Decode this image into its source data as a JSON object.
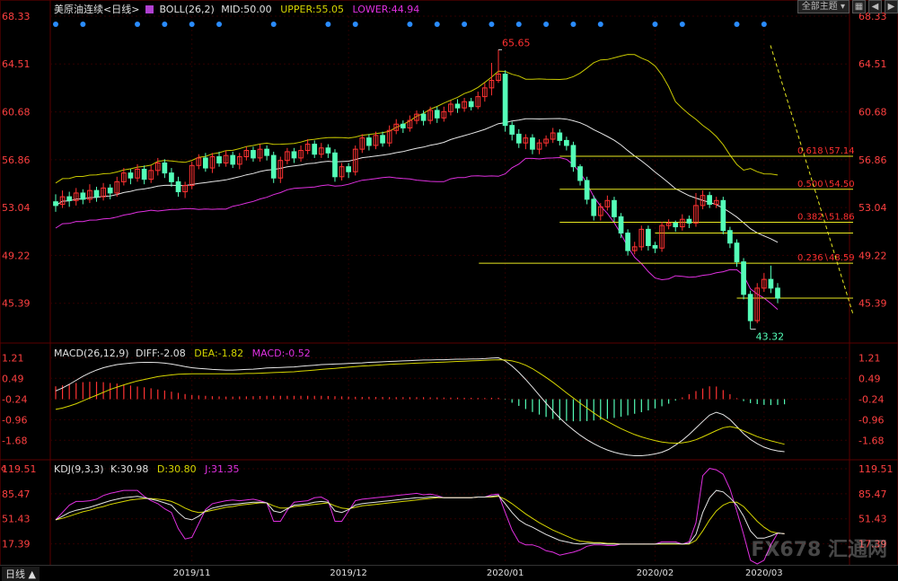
{
  "header": {
    "main": {
      "title": "美原油连续<日线>",
      "boll": "BOLL(26,2)",
      "mid": "MID:50.00",
      "upper": "UPPER:55.05",
      "lower": "LOWER:44.94"
    },
    "macd": {
      "title": "MACD(26,12,9)",
      "diff": "DIFF:-2.08",
      "dea": "DEA:-1.82",
      "macd": "MACD:-0.52"
    },
    "kdj": {
      "title": "KDJ(9,3,3)",
      "k": "K:30.98",
      "d": "D:30.80",
      "j": "J:31.35"
    }
  },
  "toolbar": {
    "theme_label": "全部主题",
    "icon1": "grid-icon",
    "icon2": "back-icon",
    "icon3": "forward-icon"
  },
  "bottom": {
    "tab_label": "日线 ▲"
  },
  "watermark": "FX678 汇通网",
  "colors": {
    "up": "#ff3232",
    "down": "#54ffb8",
    "upper": "#c8c800",
    "mid": "#e6e6e6",
    "lower": "#e030e0",
    "fib": "#e8e820",
    "axis": "#ff4040",
    "diff": "#e6e6e6",
    "dea": "#d6d600",
    "k": "#e6e6e6",
    "d": "#d6d600",
    "j": "#e030e0",
    "dot": "#2a8cff"
  },
  "chart_data": [
    {
      "type": "candlestick",
      "title": "美原油连续<日线>",
      "y_ticks": [
        "68.33",
        "64.51",
        "60.68",
        "56.86",
        "53.04",
        "49.22",
        "45.39"
      ],
      "ylim": [
        42.5,
        68.33
      ],
      "x_ticks": [
        "2019/11",
        "2019/12",
        "2020/01",
        "2020/02",
        "2020/03"
      ],
      "annotations": {
        "high": "65.65",
        "low": "43.32"
      },
      "fib_levels": [
        {
          "label": "0.618∖57.14",
          "value": 57.14
        },
        {
          "label": "0.500∖54.50",
          "value": 54.5
        },
        {
          "label": "0.382∖51.86",
          "value": 51.86
        },
        {
          "label": "0.236∖48.59",
          "value": 48.59
        }
      ],
      "horizontal_lines": [
        51.0,
        45.8
      ],
      "candles": [
        [
          53.5,
          53.2,
          54.1,
          52.7
        ],
        [
          53.3,
          53.9,
          54.4,
          53.0
        ],
        [
          53.9,
          53.6,
          54.3,
          53.1
        ],
        [
          53.6,
          54.2,
          54.6,
          53.2
        ],
        [
          54.2,
          53.7,
          54.5,
          53.3
        ],
        [
          53.7,
          54.4,
          54.9,
          53.4
        ],
        [
          54.4,
          53.9,
          54.7,
          53.5
        ],
        [
          53.9,
          54.6,
          55.0,
          53.6
        ],
        [
          54.6,
          54.2,
          54.9,
          53.7
        ],
        [
          54.2,
          55.1,
          55.5,
          53.9
        ],
        [
          55.1,
          55.8,
          56.2,
          54.8
        ],
        [
          55.8,
          55.4,
          56.1,
          54.9
        ],
        [
          55.4,
          56.1,
          56.5,
          55.1
        ],
        [
          56.1,
          55.3,
          56.4,
          54.9
        ],
        [
          55.3,
          56.0,
          56.4,
          55.0
        ],
        [
          56.0,
          56.6,
          57.0,
          55.6
        ],
        [
          56.6,
          55.8,
          56.9,
          55.4
        ],
        [
          55.8,
          55.1,
          56.2,
          54.7
        ],
        [
          55.1,
          54.3,
          55.5,
          53.9
        ],
        [
          54.3,
          54.8,
          55.1,
          53.8
        ],
        [
          54.8,
          56.4,
          56.7,
          54.5
        ],
        [
          56.4,
          57.0,
          57.3,
          56.1
        ],
        [
          57.0,
          56.2,
          57.4,
          55.9
        ],
        [
          56.2,
          57.1,
          57.4,
          55.8
        ],
        [
          57.1,
          56.6,
          57.5,
          56.3
        ],
        [
          56.6,
          57.2,
          57.6,
          56.3
        ],
        [
          57.2,
          56.5,
          57.5,
          56.2
        ],
        [
          56.5,
          57.1,
          57.4,
          56.1
        ],
        [
          57.1,
          57.6,
          57.9,
          56.8
        ],
        [
          57.6,
          57.0,
          57.9,
          56.7
        ],
        [
          57.0,
          57.7,
          58.1,
          56.7
        ],
        [
          57.7,
          57.2,
          58.0,
          56.8
        ],
        [
          57.2,
          55.4,
          57.5,
          55.0
        ],
        [
          55.4,
          56.8,
          57.1,
          55.0
        ],
        [
          56.8,
          57.5,
          57.8,
          56.5
        ],
        [
          57.5,
          57.0,
          57.8,
          56.6
        ],
        [
          57.0,
          57.6,
          58.0,
          56.7
        ],
        [
          57.6,
          58.1,
          58.5,
          57.3
        ],
        [
          58.1,
          57.3,
          58.4,
          57.0
        ],
        [
          57.3,
          57.8,
          58.2,
          57.0
        ],
        [
          57.8,
          57.4,
          58.1,
          57.0
        ],
        [
          57.4,
          55.5,
          57.7,
          55.1
        ],
        [
          55.5,
          56.3,
          56.6,
          55.2
        ],
        [
          56.3,
          55.9,
          56.6,
          55.4
        ],
        [
          55.9,
          57.7,
          58.0,
          55.6
        ],
        [
          57.7,
          58.6,
          58.9,
          57.4
        ],
        [
          58.6,
          58.0,
          58.9,
          57.6
        ],
        [
          58.0,
          58.8,
          59.1,
          57.7
        ],
        [
          58.8,
          58.2,
          59.1,
          57.9
        ],
        [
          58.2,
          59.2,
          59.6,
          57.9
        ],
        [
          59.2,
          59.7,
          60.1,
          58.9
        ],
        [
          59.7,
          59.4,
          60.0,
          59.0
        ],
        [
          59.4,
          60.0,
          60.4,
          59.1
        ],
        [
          60.0,
          60.5,
          60.8,
          59.7
        ],
        [
          60.5,
          60.0,
          60.8,
          59.6
        ],
        [
          60.0,
          60.8,
          61.1,
          59.7
        ],
        [
          60.8,
          60.2,
          61.1,
          59.8
        ],
        [
          60.2,
          60.7,
          61.1,
          59.9
        ],
        [
          60.7,
          61.3,
          61.6,
          60.4
        ],
        [
          61.3,
          61.0,
          61.7,
          60.6
        ],
        [
          61.0,
          61.5,
          61.8,
          60.7
        ],
        [
          61.5,
          61.1,
          61.8,
          60.8
        ],
        [
          61.1,
          61.9,
          62.3,
          60.9
        ],
        [
          61.9,
          62.6,
          63.0,
          61.5
        ],
        [
          62.6,
          63.2,
          64.6,
          62.0
        ],
        [
          63.2,
          63.7,
          65.65,
          63.0
        ],
        [
          63.7,
          59.6,
          64.0,
          59.1
        ],
        [
          59.6,
          58.9,
          59.9,
          58.4
        ],
        [
          58.9,
          58.2,
          59.3,
          57.8
        ],
        [
          58.2,
          58.6,
          58.9,
          57.7
        ],
        [
          58.6,
          57.7,
          58.9,
          57.3
        ],
        [
          57.7,
          58.2,
          58.5,
          57.3
        ],
        [
          58.2,
          58.5,
          58.8,
          57.9
        ],
        [
          58.5,
          59.0,
          59.4,
          58.2
        ],
        [
          59.0,
          58.4,
          59.3,
          58.0
        ],
        [
          58.4,
          58.0,
          58.7,
          57.6
        ],
        [
          58.0,
          56.3,
          58.3,
          55.9
        ],
        [
          56.3,
          55.2,
          56.5,
          54.8
        ],
        [
          55.2,
          53.7,
          55.5,
          53.3
        ],
        [
          53.7,
          52.4,
          54.0,
          52.0
        ],
        [
          52.4,
          53.1,
          53.4,
          52.0
        ],
        [
          53.1,
          53.6,
          54.0,
          52.8
        ],
        [
          53.6,
          52.3,
          53.9,
          51.9
        ],
        [
          52.3,
          51.0,
          52.6,
          50.6
        ],
        [
          51.0,
          49.6,
          51.3,
          49.2
        ],
        [
          49.6,
          49.9,
          50.3,
          49.3
        ],
        [
          49.9,
          51.3,
          51.6,
          49.6
        ],
        [
          51.3,
          50.0,
          51.6,
          49.6
        ],
        [
          50.0,
          49.8,
          50.3,
          49.4
        ],
        [
          49.8,
          51.6,
          51.9,
          49.5
        ],
        [
          51.6,
          51.8,
          52.1,
          51.3
        ],
        [
          51.8,
          51.5,
          52.0,
          51.1
        ],
        [
          51.5,
          52.1,
          52.5,
          51.2
        ],
        [
          52.1,
          51.8,
          52.4,
          51.4
        ],
        [
          51.8,
          53.2,
          54.2,
          51.5
        ],
        [
          53.2,
          54.0,
          54.4,
          52.9
        ],
        [
          54.0,
          53.3,
          54.3,
          53.0
        ],
        [
          53.3,
          53.6,
          53.9,
          53.0
        ],
        [
          53.6,
          51.2,
          53.9,
          50.9
        ],
        [
          51.2,
          50.2,
          51.5,
          49.8
        ],
        [
          50.2,
          48.7,
          50.5,
          48.3
        ],
        [
          48.7,
          46.1,
          49.0,
          45.7
        ],
        [
          46.1,
          44.0,
          46.4,
          43.32
        ],
        [
          44.0,
          46.6,
          47.0,
          43.8
        ],
        [
          46.6,
          47.3,
          47.8,
          46.3
        ],
        [
          47.3,
          46.6,
          48.4,
          46.2
        ],
        [
          46.6,
          45.8,
          47.0,
          45.4
        ]
      ],
      "bollinger": {
        "upper": 55.05,
        "mid": 50.0,
        "lower": 44.94
      }
    },
    {
      "type": "macd",
      "title": "MACD(26,12,9)",
      "y_ticks": [
        "1.21",
        "0.49",
        "-0.24",
        "-0.96",
        "-1.68"
      ],
      "ylim": [
        -2.3,
        1.6
      ],
      "diff": [
        0.05,
        0.15,
        0.28,
        0.42,
        0.56,
        0.68,
        0.78,
        0.86,
        0.92,
        0.97,
        1.0,
        1.02,
        1.04,
        1.05,
        1.05,
        1.04,
        1.02,
        0.99,
        0.95,
        0.9,
        0.86,
        0.84,
        0.82,
        0.8,
        0.79,
        0.78,
        0.78,
        0.79,
        0.8,
        0.81,
        0.83,
        0.85,
        0.86,
        0.87,
        0.88,
        0.89,
        0.91,
        0.93,
        0.95,
        0.97,
        0.98,
        0.99,
        1.0,
        1.01,
        1.02,
        1.03,
        1.05,
        1.06,
        1.07,
        1.08,
        1.09,
        1.1,
        1.11,
        1.12,
        1.13,
        1.13,
        1.14,
        1.14,
        1.15,
        1.16,
        1.16,
        1.17,
        1.17,
        1.18,
        1.2,
        1.21,
        1.1,
        0.92,
        0.7,
        0.45,
        0.18,
        -0.1,
        -0.38,
        -0.65,
        -0.9,
        -1.12,
        -1.32,
        -1.5,
        -1.66,
        -1.8,
        -1.92,
        -2.02,
        -2.1,
        -2.16,
        -2.2,
        -2.22,
        -2.22,
        -2.2,
        -2.16,
        -2.1,
        -2.0,
        -1.85,
        -1.68,
        -1.48,
        -1.25,
        -1.02,
        -0.8,
        -0.7,
        -0.78,
        -0.95,
        -1.2,
        -1.45,
        -1.65,
        -1.8,
        -1.92,
        -2.0,
        -2.05,
        -2.08
      ],
      "dea": [
        -0.6,
        -0.55,
        -0.48,
        -0.4,
        -0.3,
        -0.2,
        -0.1,
        0.0,
        0.1,
        0.18,
        0.26,
        0.33,
        0.4,
        0.45,
        0.5,
        0.55,
        0.58,
        0.61,
        0.63,
        0.64,
        0.65,
        0.65,
        0.65,
        0.65,
        0.65,
        0.65,
        0.65,
        0.65,
        0.66,
        0.66,
        0.67,
        0.68,
        0.69,
        0.7,
        0.71,
        0.72,
        0.74,
        0.76,
        0.78,
        0.8,
        0.82,
        0.84,
        0.86,
        0.88,
        0.9,
        0.92,
        0.93,
        0.95,
        0.96,
        0.98,
        0.99,
        1.0,
        1.01,
        1.02,
        1.03,
        1.04,
        1.05,
        1.06,
        1.07,
        1.08,
        1.09,
        1.1,
        1.11,
        1.12,
        1.13,
        1.14,
        1.13,
        1.1,
        1.04,
        0.95,
        0.83,
        0.68,
        0.52,
        0.35,
        0.17,
        -0.02,
        -0.2,
        -0.38,
        -0.55,
        -0.72,
        -0.88,
        -1.02,
        -1.15,
        -1.27,
        -1.38,
        -1.48,
        -1.56,
        -1.63,
        -1.69,
        -1.74,
        -1.77,
        -1.78,
        -1.77,
        -1.73,
        -1.66,
        -1.56,
        -1.45,
        -1.34,
        -1.24,
        -1.2,
        -1.25,
        -1.35,
        -1.45,
        -1.55,
        -1.63,
        -1.7,
        -1.76,
        -1.82
      ],
      "macd": [
        0.65,
        0.7,
        0.76,
        0.82,
        0.86,
        0.88,
        0.88,
        0.86,
        0.82,
        0.79,
        0.74,
        0.69,
        0.64,
        0.6,
        0.55,
        0.49,
        0.44,
        0.38,
        0.32,
        0.26,
        0.21,
        0.19,
        0.17,
        0.15,
        0.14,
        0.13,
        0.13,
        0.14,
        0.14,
        0.15,
        0.16,
        0.17,
        0.17,
        0.17,
        0.17,
        0.17,
        0.17,
        0.17,
        0.17,
        0.17,
        0.16,
        0.15,
        0.14,
        0.13,
        0.12,
        0.11,
        0.12,
        0.11,
        0.11,
        0.1,
        0.1,
        0.1,
        0.1,
        0.1,
        0.1,
        0.09,
        0.09,
        0.08,
        0.08,
        0.08,
        0.07,
        0.07,
        0.06,
        0.06,
        0.07,
        0.07,
        -0.03,
        -0.18,
        -0.34,
        -0.5,
        -0.65,
        -0.78,
        -0.9,
        -1.0,
        -1.07,
        -1.1,
        -1.12,
        -1.12,
        -1.11,
        -1.08,
        -1.04,
        -1.0,
        -0.95,
        -0.89,
        -0.82,
        -0.74,
        -0.66,
        -0.57,
        -0.47,
        -0.36,
        -0.23,
        -0.07,
        0.09,
        0.25,
        0.41,
        0.54,
        0.65,
        0.64,
        0.46,
        0.25,
        0.05,
        -0.1,
        -0.2,
        -0.25,
        -0.29,
        -0.3,
        -0.29,
        -0.26
      ]
    },
    {
      "type": "kdj",
      "title": "KDJ(9,3,3)",
      "y_ticks": [
        "119.51",
        "85.47",
        "51.43",
        "17.39"
      ],
      "ylim": [
        -10,
        128
      ],
      "k": [
        50,
        55,
        60,
        63,
        65,
        67,
        70,
        73,
        76,
        78,
        80,
        81,
        82,
        80,
        78,
        76,
        73,
        70,
        60,
        52,
        50,
        55,
        62,
        66,
        68,
        70,
        71,
        72,
        73,
        74,
        74,
        73,
        62,
        60,
        65,
        70,
        71,
        72,
        74,
        75,
        74,
        62,
        60,
        64,
        70,
        72,
        73,
        74,
        75,
        76,
        77,
        78,
        79,
        80,
        80,
        81,
        81,
        80,
        80,
        80,
        80,
        80,
        81,
        81,
        82,
        83,
        72,
        60,
        50,
        44,
        40,
        35,
        30,
        26,
        22,
        20,
        18,
        17,
        18,
        18,
        18,
        17,
        17,
        17,
        17,
        17,
        17,
        17,
        17,
        18,
        18,
        18,
        17,
        18,
        30,
        60,
        80,
        90,
        88,
        80,
        70,
        55,
        35,
        25,
        25,
        28,
        32,
        31
      ],
      "d": [
        50,
        52,
        55,
        58,
        61,
        63,
        66,
        68,
        71,
        73,
        75,
        77,
        78,
        79,
        79,
        78,
        77,
        75,
        71,
        66,
        62,
        60,
        61,
        63,
        65,
        67,
        68,
        70,
        71,
        72,
        73,
        73,
        69,
        66,
        66,
        68,
        69,
        70,
        71,
        72,
        73,
        69,
        66,
        65,
        67,
        69,
        70,
        71,
        72,
        73,
        74,
        75,
        76,
        77,
        78,
        79,
        80,
        80,
        80,
        80,
        80,
        80,
        81,
        81,
        81,
        82,
        78,
        72,
        65,
        58,
        52,
        46,
        41,
        36,
        32,
        28,
        24,
        21,
        20,
        19,
        19,
        18,
        18,
        17,
        17,
        17,
        17,
        17,
        17,
        17,
        17,
        17,
        17,
        17,
        22,
        35,
        50,
        62,
        70,
        74,
        74,
        68,
        58,
        48,
        40,
        34,
        32,
        31
      ],
      "j": [
        50,
        60,
        70,
        75,
        75,
        76,
        78,
        83,
        86,
        88,
        90,
        90,
        90,
        82,
        76,
        72,
        65,
        60,
        38,
        24,
        26,
        45,
        64,
        72,
        74,
        76,
        77,
        76,
        77,
        78,
        76,
        73,
        48,
        48,
        63,
        74,
        75,
        76,
        80,
        81,
        76,
        48,
        48,
        62,
        76,
        78,
        79,
        80,
        81,
        82,
        83,
        84,
        85,
        86,
        84,
        85,
        83,
        80,
        80,
        80,
        80,
        80,
        81,
        81,
        84,
        85,
        60,
        36,
        20,
        16,
        16,
        13,
        8,
        6,
        2,
        4,
        6,
        9,
        14,
        16,
        16,
        15,
        15,
        17,
        17,
        17,
        17,
        17,
        17,
        20,
        20,
        20,
        17,
        20,
        46,
        110,
        120,
        118,
        112,
        92,
        62,
        30,
        -5,
        -10,
        -5,
        16,
        32,
        31
      ]
    }
  ]
}
